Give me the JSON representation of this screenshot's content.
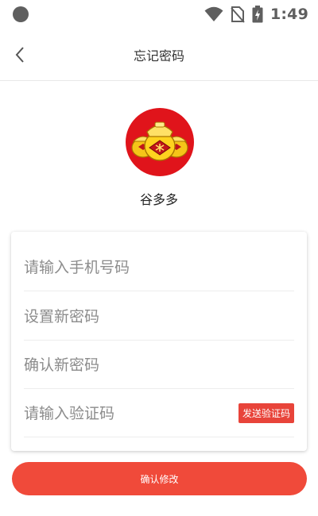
{
  "status_bar": {
    "time": "1:49",
    "icons": [
      "notification-dot-icon",
      "wifi-icon",
      "no-sim-icon",
      "battery-charging-icon"
    ]
  },
  "header": {
    "title": "忘记密码",
    "back_icon": "chevron-left-icon"
  },
  "app": {
    "name": "谷多多",
    "logo_icon": "gold-ingot-logo"
  },
  "form": {
    "phone_placeholder": "请输入手机号码",
    "new_password_placeholder": "设置新密码",
    "confirm_password_placeholder": "确认新密码",
    "code_placeholder": "请输入验证码",
    "send_code_label": "发送验证码"
  },
  "actions": {
    "confirm_label": "确认修改"
  },
  "colors": {
    "accent": "#f04a3a",
    "send_button": "#e8443a",
    "logo_background": "#e0141b"
  }
}
